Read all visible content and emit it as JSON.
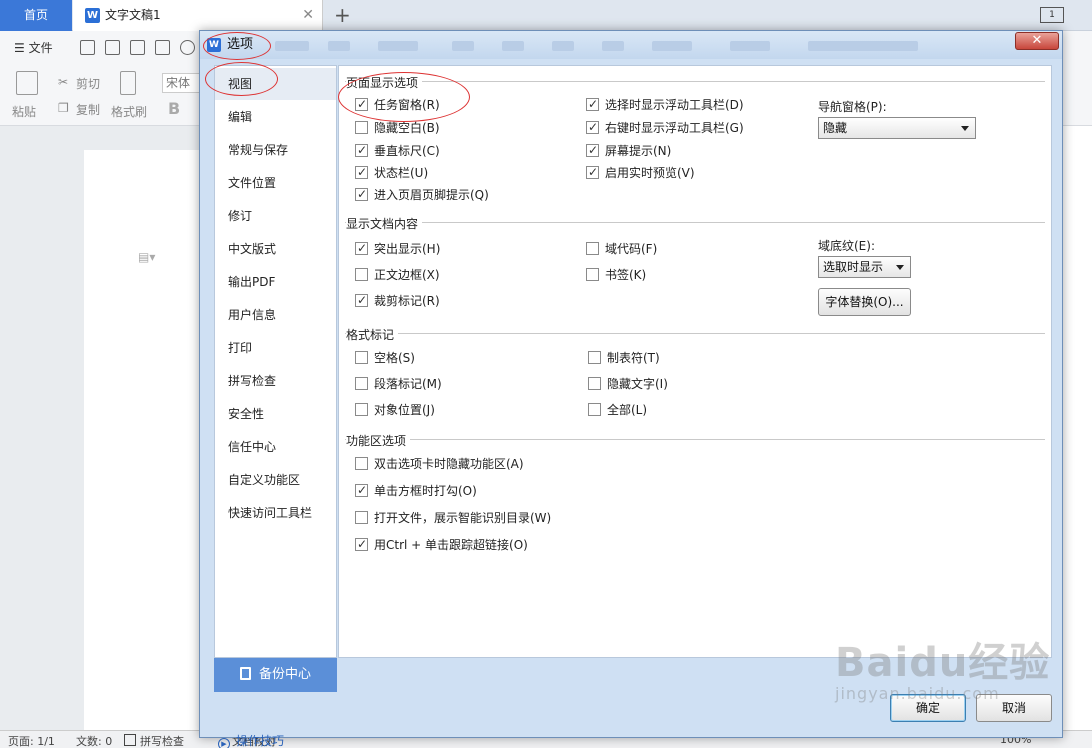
{
  "app": {
    "home_tab": "首页",
    "doc_tab": "文字文稿1",
    "tab_close": "✕",
    "new_tab": "+",
    "window_indicator": "1",
    "file_menu": "文件",
    "ribbon": {
      "font_name": "宋体",
      "paste": "粘贴",
      "cut": "剪切",
      "copy": "复制",
      "format_painter": "格式刷",
      "bold": "B"
    },
    "status": {
      "page": "页面: 1/1",
      "word_count": "文数: 0",
      "spell_check": "拼写检查",
      "doc_check": "文档校对",
      "zoom": "100%"
    }
  },
  "dialog": {
    "title": "选项",
    "close_symbol": "✕",
    "nav": [
      {
        "label": "视图",
        "active": true
      },
      {
        "label": "编辑"
      },
      {
        "label": "常规与保存"
      },
      {
        "label": "文件位置"
      },
      {
        "label": "修订"
      },
      {
        "label": "中文版式"
      },
      {
        "label": "输出PDF"
      },
      {
        "label": "用户信息"
      },
      {
        "label": "打印"
      },
      {
        "label": "拼写检查"
      },
      {
        "label": "安全性"
      },
      {
        "label": "信任中心"
      },
      {
        "label": "自定义功能区"
      },
      {
        "label": "快速访问工具栏"
      }
    ],
    "backup_center": "备份中心",
    "tips": "操作技巧",
    "sections": {
      "page_display": {
        "title": "页面显示选项",
        "left": [
          {
            "label": "任务窗格(R)",
            "checked": true
          },
          {
            "label": "隐藏空白(B)",
            "checked": false
          },
          {
            "label": "垂直标尺(C)",
            "checked": true
          },
          {
            "label": "状态栏(U)",
            "checked": true
          },
          {
            "label": "进入页眉页脚提示(Q)",
            "checked": true
          }
        ],
        "mid": [
          {
            "label": "选择时显示浮动工具栏(D)",
            "checked": true
          },
          {
            "label": "右键时显示浮动工具栏(G)",
            "checked": true
          },
          {
            "label": "屏幕提示(N)",
            "checked": true
          },
          {
            "label": "启用实时预览(V)",
            "checked": true
          }
        ],
        "nav_pane_label": "导航窗格(P):",
        "nav_pane_value": "隐藏"
      },
      "doc_content": {
        "title": "显示文档内容",
        "left": [
          {
            "label": "突出显示(H)",
            "checked": true
          },
          {
            "label": "正文边框(X)",
            "checked": false
          },
          {
            "label": "裁剪标记(R)",
            "checked": true
          }
        ],
        "mid": [
          {
            "label": "域代码(F)",
            "checked": false
          },
          {
            "label": "书签(K)",
            "checked": false
          }
        ],
        "field_shading_label": "域底纹(E):",
        "field_shading_value": "选取时显示",
        "font_substitution": "字体替换(O)..."
      },
      "format_marks": {
        "title": "格式标记",
        "left": [
          {
            "label": "空格(S)",
            "checked": false
          },
          {
            "label": "段落标记(M)",
            "checked": false
          },
          {
            "label": "对象位置(J)",
            "checked": false
          }
        ],
        "mid": [
          {
            "label": "制表符(T)",
            "checked": false
          },
          {
            "label": "隐藏文字(I)",
            "checked": false
          },
          {
            "label": "全部(L)",
            "checked": false
          }
        ]
      },
      "ribbon_options": {
        "title": "功能区选项",
        "items": [
          {
            "label": "双击选项卡时隐藏功能区(A)",
            "checked": false
          },
          {
            "label": "单击方框时打勾(O)",
            "checked": true
          },
          {
            "label": "打开文件，展示智能识别目录(W)",
            "checked": false
          },
          {
            "label": "用Ctrl + 单击跟踪超链接(O)",
            "checked": true
          }
        ]
      }
    },
    "ok": "确定",
    "cancel": "取消"
  },
  "watermark": {
    "line1": "Baidu经验",
    "line2": "jingyan.baidu.com"
  },
  "colors": {
    "accent": "#3b78d8",
    "backup_bg": "#5b8fd8",
    "annotation": "#dd3333",
    "dialog_frame": "#cfe0f3"
  }
}
